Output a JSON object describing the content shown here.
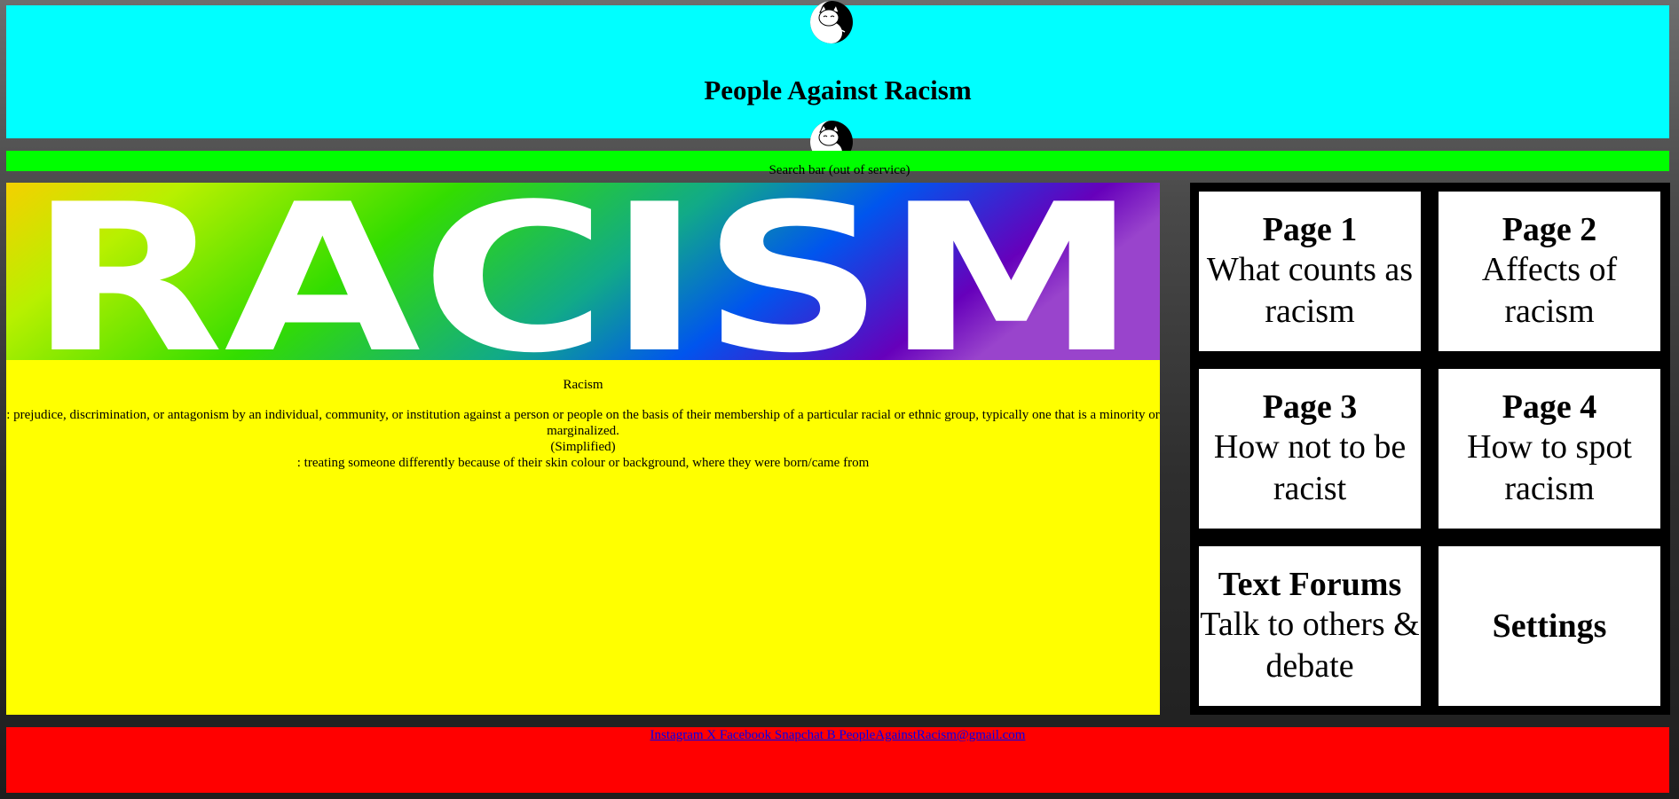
{
  "header": {
    "title": "People Against Racism"
  },
  "search": {
    "label": "Search bar (out of service)"
  },
  "banner": {
    "text": "RACISM"
  },
  "definition": {
    "title": "Racism",
    "line1": ": prejudice, discrimination, or antagonism by an individual, community, or institution against a person or people on the basis of their membership of a particular racial or ethnic group, typically one that is a minority or marginalized.",
    "line2": "(Simplified)",
    "line3": ": treating someone differently because of their skin colour or background, where they were born/came from"
  },
  "nav": {
    "tiles": [
      {
        "title": "Page 1",
        "desc": "What counts as racism"
      },
      {
        "title": "Page 2",
        "desc": "Affects of racism"
      },
      {
        "title": "Page 3",
        "desc": "How not to be racist"
      },
      {
        "title": "Page 4",
        "desc": "How to spot racism"
      },
      {
        "title": "Text Forums",
        "desc": "Talk to others & debate"
      },
      {
        "title": "Settings",
        "desc": ""
      }
    ]
  },
  "footer": {
    "links": "Instagram X Facebook Snapchat B PeopleAgainstRacism@gmail.com"
  },
  "colors": {
    "header": "#00ffff",
    "search": "#00ff00",
    "content": "#ffff00",
    "footer": "#ff0000",
    "nav_panel": "#000000",
    "tile": "#ffffff"
  }
}
